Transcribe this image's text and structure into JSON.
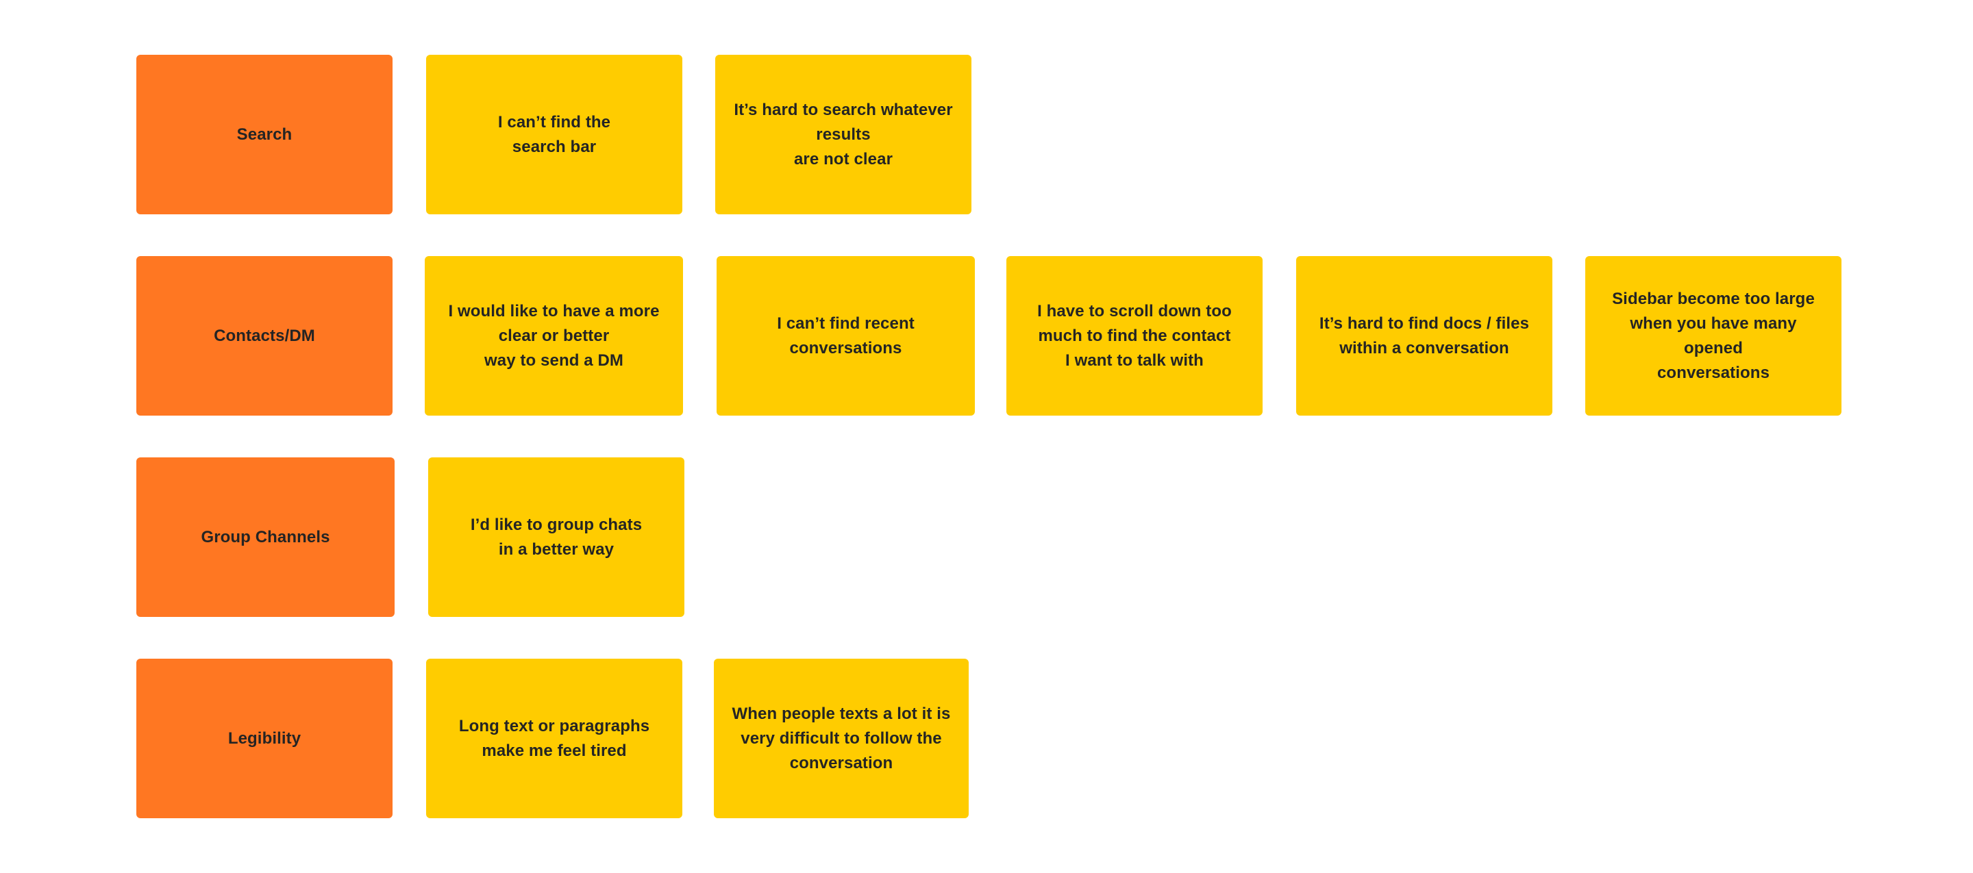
{
  "colors": {
    "category": "#FF7722",
    "note": "#FFCC00",
    "text": "#242424",
    "background": "#FFFFFF"
  },
  "rows": [
    {
      "category": "Search",
      "notes": [
        "I can’t find the\nsearch bar",
        "It’s hard to search whatever\nresults\nare not clear"
      ]
    },
    {
      "category": "Contacts/DM",
      "notes": [
        "I would like to have a more\nclear or better\nway to send a DM",
        "I can’t find recent\nconversations",
        "I have to scroll down too\nmuch to find the contact\nI want to talk with",
        "It’s hard to find docs / files\nwithin a conversation",
        "Sidebar become too large\nwhen you have many opened\nconversations"
      ]
    },
    {
      "category": "Group Channels",
      "notes": [
        "I’d like to group chats\nin a better way"
      ]
    },
    {
      "category": "Legibility",
      "notes": [
        "Long text or paragraphs\nmake me feel tired",
        "When people texts a lot it is\nvery difficult to follow the\nconversation"
      ]
    }
  ]
}
